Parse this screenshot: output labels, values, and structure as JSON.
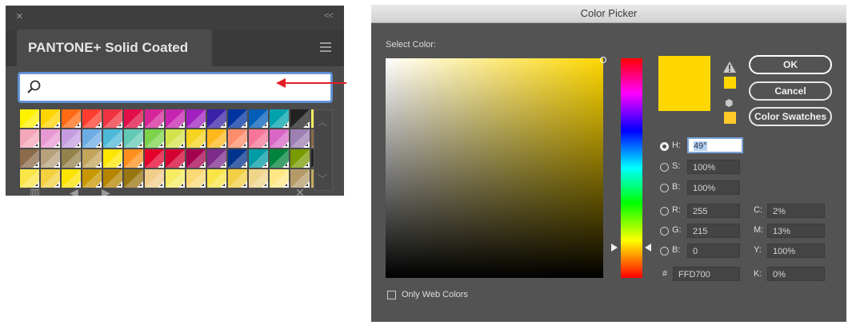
{
  "swatches_panel": {
    "close_glyph": "×",
    "collapse_glyph": "<<",
    "library_tab": "PANTONE+ Solid Coated",
    "search": {
      "value": "",
      "placeholder": ""
    },
    "icons": [
      "search-icon",
      "menu-icon",
      "library-icon",
      "previous-icon",
      "next-icon",
      "delete-icon"
    ],
    "swatch_rows": [
      [
        "#fff200",
        "#ffd400",
        "#ff6a13",
        "#ff3d2e",
        "#ef3340",
        "#e10e49",
        "#d62598",
        "#c724b1",
        "#a020c0",
        "#3a22a8",
        "#0033a0",
        "#005eb8",
        "#00a3ad",
        "#222222",
        "#f3ea5d"
      ],
      [
        "#f4a7b9",
        "#e899d3",
        "#c59ce0",
        "#6cace4",
        "#4eb8d9",
        "#63c9b5",
        "#7bd34a",
        "#d3e34b",
        "#f6d31e",
        "#ffb81c",
        "#ff8d6d",
        "#f67599",
        "#d966c4",
        "#9d7fb3",
        "#8c6c4a"
      ],
      [
        "#8b6b4a",
        "#b7a07c",
        "#95824a",
        "#c2a45a",
        "#ffe600",
        "#ff8f1c",
        "#e4002b",
        "#d50032",
        "#a50050",
        "#7d2b8b",
        "#00338d",
        "#009ca6",
        "#00843d",
        "#7a9a01",
        "#222222"
      ],
      [
        "#f9e547",
        "#f3d03e",
        "#fce300",
        "#c99700",
        "#b58500",
        "#9a7611",
        "#f2cd8a",
        "#f6eb61",
        "#fbd872",
        "#f9e547",
        "#f3cf45",
        "#efd48a",
        "#ffe785",
        "#b49a67",
        "#c4a95c"
      ]
    ],
    "annotation_arrow_color": "#e31e24"
  },
  "color_picker": {
    "title": "Color Picker",
    "select_color_label": "Select Color:",
    "buttons": {
      "ok": "OK",
      "cancel": "Cancel",
      "swatches": "Color Swatches"
    },
    "current_color": "#ffd700",
    "hsb": [
      {
        "key": "H:",
        "value": "49°",
        "selected": true
      },
      {
        "key": "S:",
        "value": "100%",
        "selected": false
      },
      {
        "key": "B:",
        "value": "100%",
        "selected": false
      }
    ],
    "rgb": [
      {
        "key": "R:",
        "value": "255"
      },
      {
        "key": "G:",
        "value": "215"
      },
      {
        "key": "B:",
        "value": "0"
      }
    ],
    "hex": {
      "key": "#",
      "value": "FFD700"
    },
    "cmyk": [
      {
        "key": "C:",
        "value": "2%"
      },
      {
        "key": "M:",
        "value": "13%"
      },
      {
        "key": "Y:",
        "value": "100%"
      },
      {
        "key": "K:",
        "value": "0%"
      }
    ],
    "only_web_colors": "Only Web Colors",
    "gamut_colors": [
      "#ffd700",
      "#ffca28"
    ]
  }
}
